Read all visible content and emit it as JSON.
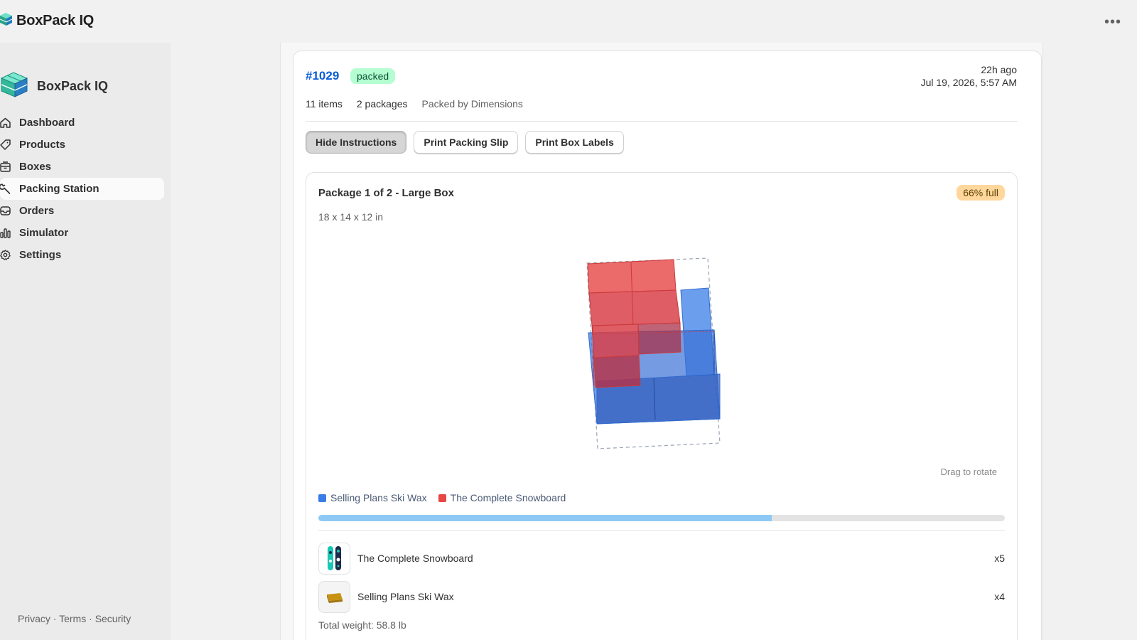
{
  "app": {
    "title": "BoxPack IQ",
    "menu_icon": "more-horizontal-icon"
  },
  "sidebar": {
    "brand": "BoxPack IQ",
    "items": [
      {
        "label": "Dashboard",
        "icon": "home-icon",
        "active": false
      },
      {
        "label": "Products",
        "icon": "tag-icon",
        "active": false
      },
      {
        "label": "Boxes",
        "icon": "box-icon",
        "active": false
      },
      {
        "label": "Packing Station",
        "icon": "wrench-icon",
        "active": true
      },
      {
        "label": "Orders",
        "icon": "inbox-icon",
        "active": false
      },
      {
        "label": "Simulator",
        "icon": "bar-chart-icon",
        "active": false
      },
      {
        "label": "Settings",
        "icon": "gear-icon",
        "active": false
      }
    ],
    "footer": {
      "privacy": "Privacy",
      "terms": "Terms",
      "security": "Security",
      "separator": " · "
    }
  },
  "order": {
    "number": "#1029",
    "status": "packed",
    "time_ago": "22h ago",
    "timestamp": "Jul 19, 2026, 5:57 AM",
    "items_count": "11 items",
    "packages_count": "2 packages",
    "packed_by": "Packed by Dimensions"
  },
  "actions": {
    "hide_instructions": "Hide Instructions",
    "print_packing_slip": "Print Packing Slip",
    "print_box_labels": "Print Box Labels"
  },
  "package": {
    "title": "Package 1 of 2 - Large Box",
    "fill_label": "66% full",
    "fill_fraction": 0.66,
    "dimensions": "18 x 14 x 12 in",
    "drag_hint": "Drag to rotate",
    "legend": [
      {
        "name": "Selling Plans Ski Wax",
        "color": "#3b7de8"
      },
      {
        "name": "The Complete Snowboard",
        "color": "#e84545"
      }
    ],
    "bar_color": "#8ec9f6",
    "items": [
      {
        "name": "The Complete Snowboard",
        "qty": "x5",
        "thumb": "snowboard-thumb"
      },
      {
        "name": "Selling Plans Ski Wax",
        "qty": "x4",
        "thumb": "ski-wax-thumb"
      }
    ],
    "total_weight": "Total weight: 58.8 lb"
  },
  "colors": {
    "link": "#0b5cd5",
    "packed_badge_bg": "#b4fed2",
    "full_badge_bg": "#ffd79d",
    "wax": "#3b7de8",
    "snowboard": "#e84545"
  }
}
